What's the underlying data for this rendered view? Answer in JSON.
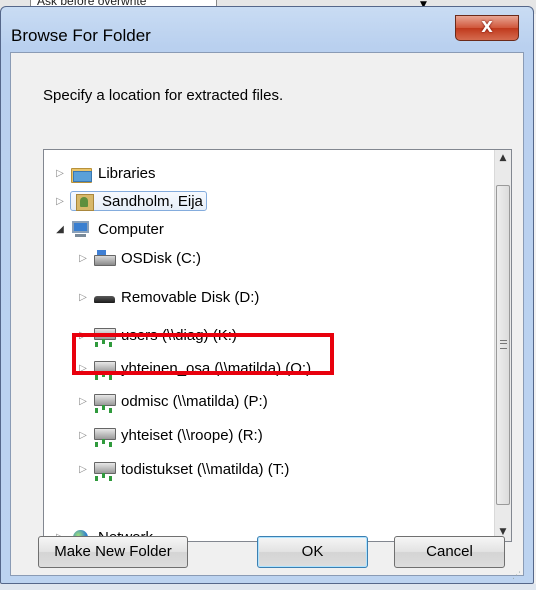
{
  "background": {
    "hint_text": "Ask before overwrite"
  },
  "window": {
    "title": "Browse For Folder",
    "close_label": "X"
  },
  "prompt": "Specify a location for extracted files.",
  "tree": {
    "items": [
      {
        "label": "Libraries",
        "icon": "libraries-icon",
        "expander": "▷"
      },
      {
        "label": "Sandholm, Eija",
        "icon": "user-folder-icon",
        "expander": "▷",
        "selected": true
      },
      {
        "label": "Computer",
        "icon": "computer-icon",
        "expander": "◢"
      },
      {
        "label": "OSDisk (C:)",
        "icon": "hard-drive-icon",
        "expander": "▷"
      },
      {
        "label": "Removable Disk (D:)",
        "icon": "removable-disk-icon",
        "expander": "▷",
        "highlighted": true
      },
      {
        "label": "users (\\\\diag) (K:)",
        "icon": "network-drive-icon",
        "expander": "▷"
      },
      {
        "label": "yhteinen_osa (\\\\matilda) (O:)",
        "icon": "network-drive-icon",
        "expander": "▷"
      },
      {
        "label": "odmisc (\\\\matilda) (P:)",
        "icon": "network-drive-icon",
        "expander": "▷"
      },
      {
        "label": "yhteiset (\\\\roope) (R:)",
        "icon": "network-drive-icon",
        "expander": "▷"
      },
      {
        "label": "todistukset (\\\\matilda) (T:)",
        "icon": "network-drive-icon",
        "expander": "▷"
      },
      {
        "label": "Network",
        "icon": "network-icon",
        "expander": "▷"
      }
    ],
    "scroll": {
      "up": "▲",
      "down": "▼",
      "grip": "≡"
    }
  },
  "buttons": {
    "make_new_folder": "Make New Folder",
    "ok": "OK",
    "cancel": "Cancel"
  },
  "colors": {
    "highlight": "#e8000d",
    "selection_border": "#84acdd",
    "close_button": "#c0391c"
  }
}
